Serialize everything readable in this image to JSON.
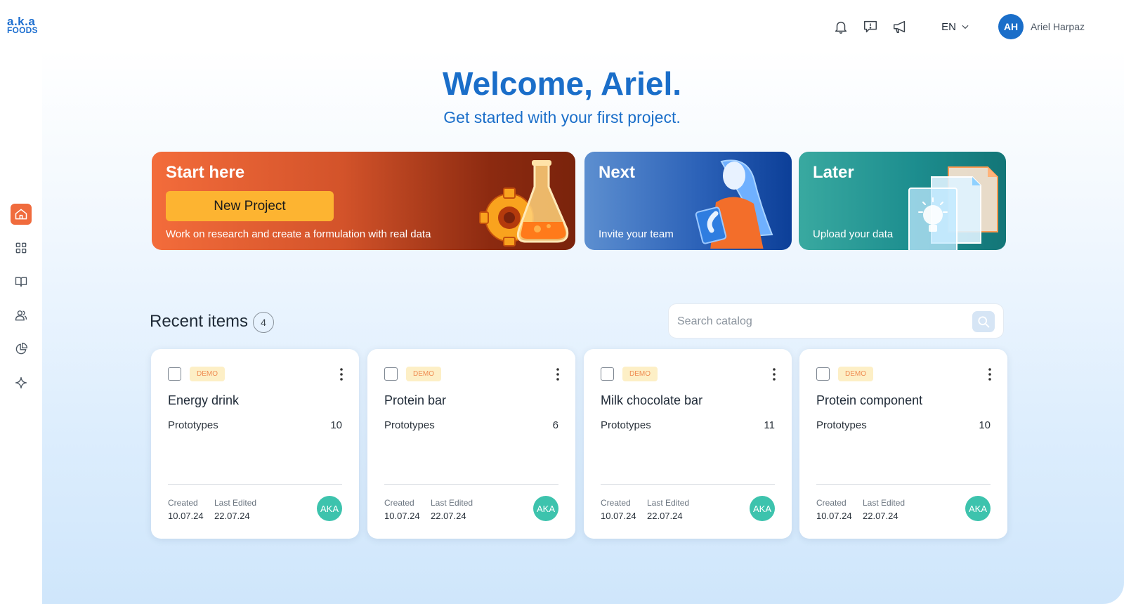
{
  "logo": {
    "line1": "a.k.a",
    "line2": "FOODS"
  },
  "header": {
    "icons": [
      "bell-icon",
      "feedback-icon",
      "megaphone-icon"
    ],
    "language": "EN",
    "user_initials": "AH",
    "user_name": "Ariel Harpaz"
  },
  "sidebar": {
    "items": [
      {
        "icon": "home-icon",
        "active": true
      },
      {
        "icon": "grid-icon",
        "active": false
      },
      {
        "icon": "book-icon",
        "active": false
      },
      {
        "icon": "team-icon",
        "active": false
      },
      {
        "icon": "pie-chart-icon",
        "active": false
      },
      {
        "icon": "sparkle-icon",
        "active": false
      }
    ]
  },
  "welcome": {
    "title": "Welcome, Ariel.",
    "subtitle": "Get started with your first project."
  },
  "hero": {
    "start": {
      "title": "Start here",
      "button": "New Project",
      "description": "Work on research and create a formulation with real data"
    },
    "next": {
      "title": "Next",
      "description": "Invite your team"
    },
    "later": {
      "title": "Later",
      "description": "Upload your data"
    }
  },
  "recent": {
    "title": "Recent items",
    "count": "4",
    "search_placeholder": "Search catalog",
    "cards": [
      {
        "badge": "DEMO",
        "title": "Energy drink",
        "prototypes_label": "Prototypes",
        "prototypes": "10",
        "created_label": "Created",
        "created": "10.07.24",
        "edited_label": "Last Edited",
        "edited": "22.07.24",
        "owner": "AKA"
      },
      {
        "badge": "DEMO",
        "title": "Protein bar",
        "prototypes_label": "Prototypes",
        "prototypes": "6",
        "created_label": "Created",
        "created": "10.07.24",
        "edited_label": "Last Edited",
        "edited": "22.07.24",
        "owner": "AKA"
      },
      {
        "badge": "DEMO",
        "title": "Milk chocolate bar",
        "prototypes_label": "Prototypes",
        "prototypes": "11",
        "created_label": "Created",
        "created": "10.07.24",
        "edited_label": "Last Edited",
        "edited": "22.07.24",
        "owner": "AKA"
      },
      {
        "badge": "DEMO",
        "title": "Protein component",
        "prototypes_label": "Prototypes",
        "prototypes": "10",
        "created_label": "Created",
        "created": "10.07.24",
        "edited_label": "Last Edited",
        "edited": "22.07.24",
        "owner": "AKA"
      }
    ]
  },
  "colors": {
    "brand_blue": "#1a6ec9",
    "accent_orange": "#f06b3d",
    "button_yellow": "#fdb431",
    "owner_teal": "#3dc3ad",
    "badge_bg": "#fdefc6",
    "badge_text": "#ef8c52"
  }
}
